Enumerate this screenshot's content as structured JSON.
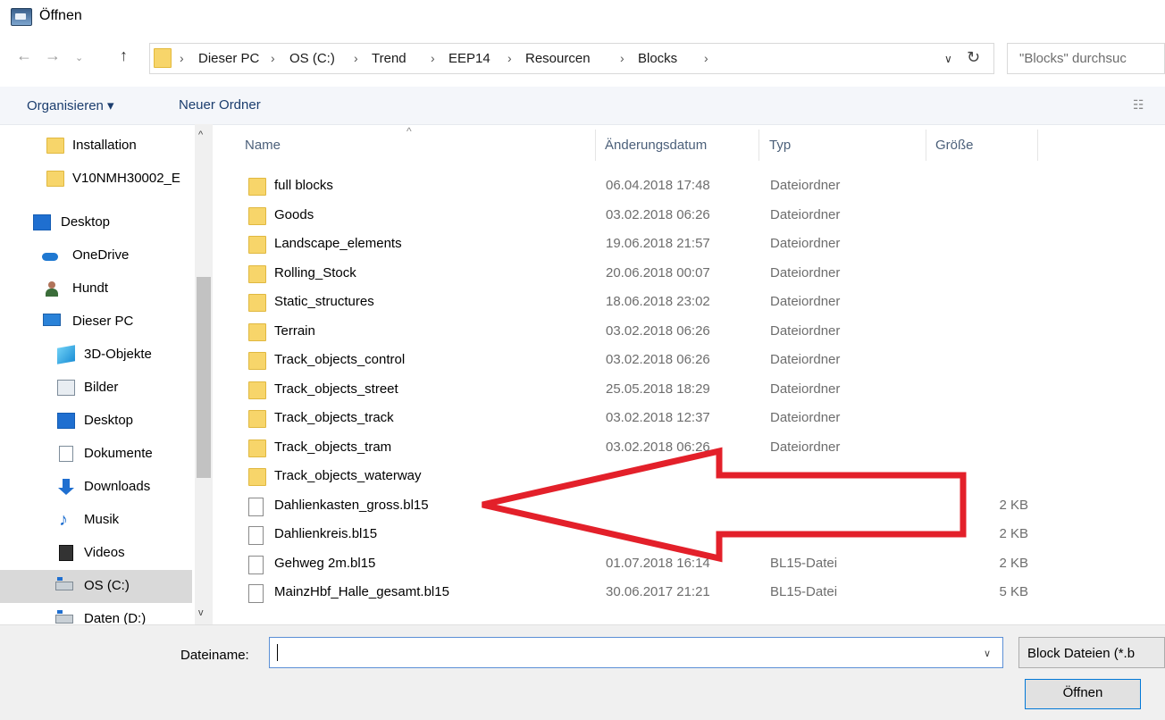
{
  "window": {
    "title": "Öffnen"
  },
  "address": {
    "crumbs": [
      "Dieser PC",
      "OS (C:)",
      "Trend",
      "EEP14",
      "Resourcen",
      "Blocks"
    ],
    "search_placeholder": "\"Blocks\" durchsuc"
  },
  "toolbar": {
    "organize_label": "Organisieren ▾",
    "new_folder_label": "Neuer Ordner"
  },
  "sidebar": {
    "items": [
      {
        "label": "Installation",
        "icon": "folder-icon"
      },
      {
        "label": "V10NMH30002_E",
        "icon": "folder-icon"
      },
      {
        "label": "Desktop",
        "icon": "desktop-icon"
      },
      {
        "label": "OneDrive",
        "icon": "onedrive-icon"
      },
      {
        "label": "Hundt",
        "icon": "user-icon"
      },
      {
        "label": "Dieser PC",
        "icon": "computer-icon"
      },
      {
        "label": "3D-Objekte",
        "icon": "cube-icon"
      },
      {
        "label": "Bilder",
        "icon": "pictures-icon"
      },
      {
        "label": "Desktop",
        "icon": "desktop-icon"
      },
      {
        "label": "Dokumente",
        "icon": "documents-icon"
      },
      {
        "label": "Downloads",
        "icon": "download-icon"
      },
      {
        "label": "Musik",
        "icon": "music-icon"
      },
      {
        "label": "Videos",
        "icon": "video-icon"
      },
      {
        "label": "OS (C:)",
        "icon": "drive-icon",
        "selected": true
      },
      {
        "label": "Daten (D:)",
        "icon": "drive-icon"
      }
    ]
  },
  "columns": {
    "name": "Name",
    "date": "Änderungsdatum",
    "type": "Typ",
    "size": "Größe"
  },
  "files": [
    {
      "name": "full blocks",
      "date": "06.04.2018 17:48",
      "type": "Dateiordner",
      "size": "",
      "kind": "folder"
    },
    {
      "name": "Goods",
      "date": "03.02.2018 06:26",
      "type": "Dateiordner",
      "size": "",
      "kind": "folder"
    },
    {
      "name": "Landscape_elements",
      "date": "19.06.2018 21:57",
      "type": "Dateiordner",
      "size": "",
      "kind": "folder"
    },
    {
      "name": "Rolling_Stock",
      "date": "20.06.2018 00:07",
      "type": "Dateiordner",
      "size": "",
      "kind": "folder"
    },
    {
      "name": "Static_structures",
      "date": "18.06.2018 23:02",
      "type": "Dateiordner",
      "size": "",
      "kind": "folder"
    },
    {
      "name": "Terrain",
      "date": "03.02.2018 06:26",
      "type": "Dateiordner",
      "size": "",
      "kind": "folder"
    },
    {
      "name": "Track_objects_control",
      "date": "03.02.2018 06:26",
      "type": "Dateiordner",
      "size": "",
      "kind": "folder"
    },
    {
      "name": "Track_objects_street",
      "date": "25.05.2018 18:29",
      "type": "Dateiordner",
      "size": "",
      "kind": "folder"
    },
    {
      "name": "Track_objects_track",
      "date": "03.02.2018 12:37",
      "type": "Dateiordner",
      "size": "",
      "kind": "folder"
    },
    {
      "name": "Track_objects_tram",
      "date": "03.02.2018 06:26",
      "type": "Dateiordner",
      "size": "",
      "kind": "folder"
    },
    {
      "name": "Track_objects_waterway",
      "date": "",
      "type": "",
      "size": "",
      "kind": "folder"
    },
    {
      "name": "Dahlienkasten_gross.bl15",
      "date": "",
      "type": "",
      "size": "2 KB",
      "kind": "file"
    },
    {
      "name": "Dahlienkreis.bl15",
      "date": "",
      "type": "",
      "size": "2 KB",
      "kind": "file"
    },
    {
      "name": "Gehweg 2m.bl15",
      "date": "01.07.2018 16:14",
      "type": "BL15-Datei",
      "size": "2 KB",
      "kind": "file"
    },
    {
      "name": "MainzHbf_Halle_gesamt.bl15",
      "date": "30.06.2017 21:21",
      "type": "BL15-Datei",
      "size": "5 KB",
      "kind": "file"
    }
  ],
  "footer": {
    "filename_label": "Dateiname:",
    "filename_value": "",
    "filter_label": "Block Dateien (*.b",
    "open_label": "Öffnen"
  },
  "colors": {
    "folder": "#f7d56a",
    "accent": "#0078d7",
    "annotation_arrow": "#e3202a"
  }
}
